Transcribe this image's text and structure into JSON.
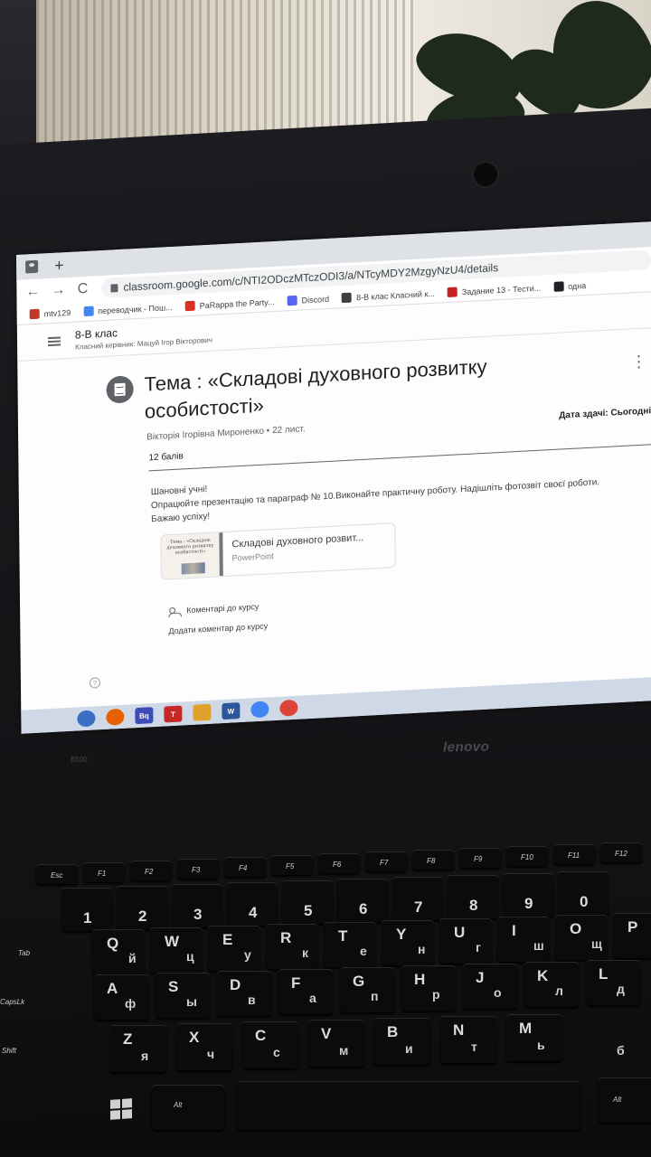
{
  "browser": {
    "new_tab": "+",
    "nav": {
      "back": "←",
      "forward": "→",
      "reload": "C"
    },
    "url": "classroom.google.com/c/NTI2ODczMTczODI3/a/NTcyMDY2MzgyNzU4/details",
    "bookmarks": [
      {
        "label": "mtv129",
        "color": "#c0392b"
      },
      {
        "label": "переводчик - Пош...",
        "color": "#4285f4"
      },
      {
        "label": "PaRappa the Party...",
        "color": "#d93025"
      },
      {
        "label": "Discord",
        "color": "#5865f2"
      },
      {
        "label": "8-В клас Класний к...",
        "color": "#3c4043"
      },
      {
        "label": "Задание 13 - Тести...",
        "color": "#c5221f"
      },
      {
        "label": "одна",
        "color": "#202124"
      }
    ]
  },
  "classroom": {
    "class_name": "8-В клас",
    "teacher_line": "Класний керівник: Мацуй Ігор Вікторович",
    "assignment": {
      "title": "Тема : «Складові духовного розвитку особистості»",
      "author_date": "Вікторія Ігорівна Мироненко • 22 лист.",
      "due": "Дата здачі: Сьогодні",
      "points": "12 балів",
      "body": [
        "Шановні учні!",
        "Опрацюйте презентацію та параграф № 10.Виконайте практичну роботу. Надішліть фотозвіт своєї роботи.",
        "Бажаю успіху!"
      ],
      "attachment": {
        "thumb_text": "Тема : «Складові духовного розвитку особистості»",
        "name": "Складові духовного розвит...",
        "type": "PowerPoint"
      },
      "comments_label": "Коментарі до курсу",
      "add_comment": "Додати коментар до курсу"
    },
    "help": "?"
  },
  "taskbar": [
    {
      "name": "start",
      "label": "",
      "color": "#3a6fc4"
    },
    {
      "name": "firefox",
      "label": "",
      "color": "#e66000"
    },
    {
      "name": "bq",
      "label": "Bq",
      "color": "#3d4db7"
    },
    {
      "name": "app-t",
      "label": "T",
      "color": "#c62828"
    },
    {
      "name": "explorer",
      "label": "",
      "color": "#e0a02c"
    },
    {
      "name": "word",
      "label": "W",
      "color": "#2b579a"
    },
    {
      "name": "chrome",
      "label": "",
      "color": "#4285f4"
    },
    {
      "name": "chrome-2",
      "label": "",
      "color": "#db4437"
    }
  ],
  "laptop": {
    "brand": "lenovo",
    "model": "B590"
  },
  "keyboard": {
    "fn_keys": [
      "Esc",
      "F1",
      "F2",
      "F3",
      "F4",
      "F5",
      "F6",
      "F7",
      "F8",
      "F9",
      "F10",
      "F11",
      "F12"
    ],
    "number_row": [
      "1",
      "2",
      "3",
      "4",
      "5",
      "6",
      "7",
      "8",
      "9",
      "0"
    ],
    "row_q": [
      "Q",
      "W",
      "E",
      "R",
      "T",
      "Y",
      "U",
      "I",
      "O",
      "P"
    ],
    "row_q_cyr": [
      "й",
      "ц",
      "у",
      "к",
      "е",
      "н",
      "г",
      "ш",
      "щ"
    ],
    "row_a": [
      "A",
      "S",
      "D",
      "F",
      "G",
      "H",
      "J",
      "K",
      "L"
    ],
    "row_a_cyr": [
      "ф",
      "ы",
      "в",
      "а",
      "п",
      "р",
      "о",
      "л",
      "д"
    ],
    "row_z": [
      "Z",
      "X",
      "C",
      "V",
      "B",
      "N",
      "M"
    ],
    "row_z_cyr": [
      "я",
      "ч",
      "с",
      "м",
      "и",
      "т",
      "ь",
      "б"
    ],
    "mods": {
      "tab": "Tab",
      "caps": "CapsLk",
      "shift": "Shift",
      "alt_left": "Alt",
      "alt_right": "Alt"
    }
  }
}
